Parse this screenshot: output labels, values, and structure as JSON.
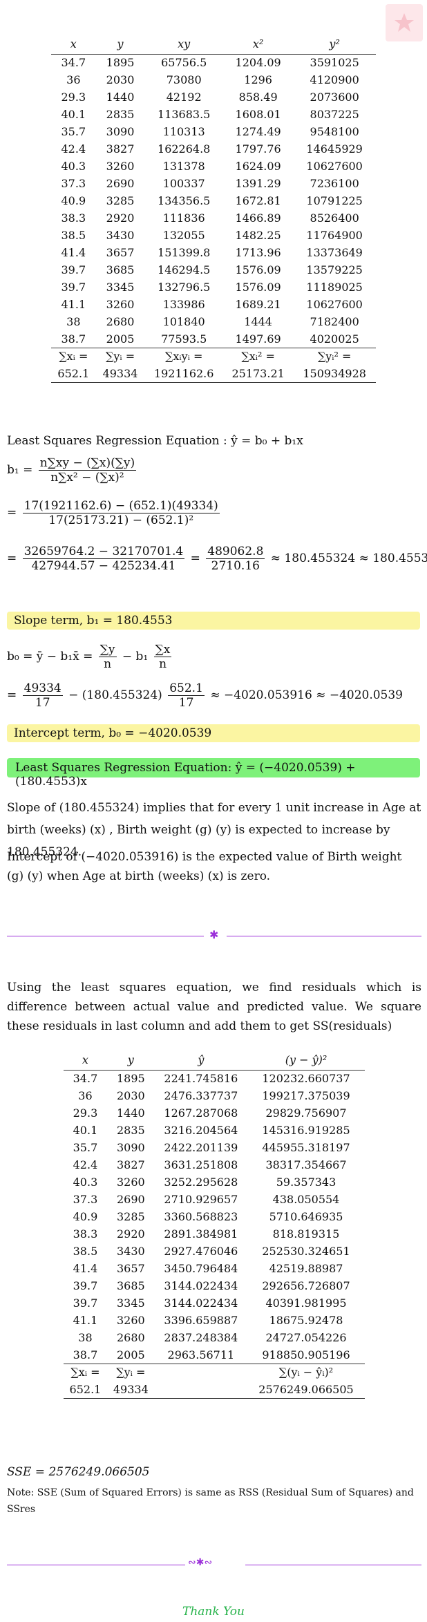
{
  "table1": {
    "headers": [
      "x",
      "y",
      "xy",
      "x²",
      "y²"
    ],
    "rows": [
      [
        "34.7",
        "1895",
        "65756.5",
        "1204.09",
        "3591025"
      ],
      [
        "36",
        "2030",
        "73080",
        "1296",
        "4120900"
      ],
      [
        "29.3",
        "1440",
        "42192",
        "858.49",
        "2073600"
      ],
      [
        "40.1",
        "2835",
        "113683.5",
        "1608.01",
        "8037225"
      ],
      [
        "35.7",
        "3090",
        "110313",
        "1274.49",
        "9548100"
      ],
      [
        "42.4",
        "3827",
        "162264.8",
        "1797.76",
        "14645929"
      ],
      [
        "40.3",
        "3260",
        "131378",
        "1624.09",
        "10627600"
      ],
      [
        "37.3",
        "2690",
        "100337",
        "1391.29",
        "7236100"
      ],
      [
        "40.9",
        "3285",
        "134356.5",
        "1672.81",
        "10791225"
      ],
      [
        "38.3",
        "2920",
        "111836",
        "1466.89",
        "8526400"
      ],
      [
        "38.5",
        "3430",
        "132055",
        "1482.25",
        "11764900"
      ],
      [
        "41.4",
        "3657",
        "151399.8",
        "1713.96",
        "13373649"
      ],
      [
        "39.7",
        "3685",
        "146294.5",
        "1576.09",
        "13579225"
      ],
      [
        "39.7",
        "3345",
        "132796.5",
        "1576.09",
        "11189025"
      ],
      [
        "41.1",
        "3260",
        "133986",
        "1689.21",
        "10627600"
      ],
      [
        "38",
        "2680",
        "101840",
        "1444",
        "7182400"
      ],
      [
        "38.7",
        "2005",
        "77593.5",
        "1497.69",
        "4020025"
      ]
    ],
    "sum_labels": [
      "∑xᵢ =",
      "∑yᵢ =",
      "∑xᵢyᵢ =",
      "∑xᵢ² =",
      "∑yᵢ² ="
    ],
    "sum_values": [
      "652.1",
      "49334",
      "1921162.6",
      "25173.21",
      "150934928"
    ]
  },
  "regression": {
    "eq_title": "Least Squares Regression Equation : ŷ = b₀ + b₁x",
    "b1_formula": "b₁ =",
    "b1_num": "n∑xy − (∑x)(∑y)",
    "b1_den": "n∑x² − (∑x)²",
    "sub_num": "17(1921162.6) − (652.1)(49334)",
    "sub_den": "17(25173.21) − (652.1)²",
    "calc_num1": "32659764.2 − 32170701.4",
    "calc_den1": "427944.57 − 425234.41",
    "calc_num2": "489062.8",
    "calc_den2": "2710.16",
    "calc_result": "≈ 180.455324 ≈ 180.4553",
    "slope_box": "Slope term, b₁ = 180.4553",
    "b0_lhs": "b₀ = ȳ − b₁x̄ =",
    "b0_num1": "∑y",
    "b0_den1": "n",
    "b0_mid": "− b₁",
    "b0_num2": "∑x",
    "b0_den2": "n",
    "b0_sub_num1": "49334",
    "b0_sub_den1": "17",
    "b0_sub_mid": "− (180.455324)",
    "b0_sub_num2": "652.1",
    "b0_sub_den2": "17",
    "b0_result": "≈ −4020.053916 ≈ −4020.0539",
    "intercept_box": "Intercept term, b₀ = −4020.0539",
    "final_box": "Least Squares Regression Equation: ŷ = (−4020.0539) + (180.4553)x"
  },
  "interpretation": {
    "slope_text": "Slope of (180.455324) implies that for every 1 unit increase in Age at birth (weeks) (x) , Birth weight (g) (y) is expected to increase by 180.455324.",
    "intercept_text": "Intercept of (−4020.053916) is the expected value of Birth weight (g) (y) when Age at birth (weeks) (x) is zero."
  },
  "residuals_intro": "Using the least squares equation, we find residuals which is difference between actual value and predicted value. We square these residuals in last column and add them to get SS(residuals)",
  "table2": {
    "headers": [
      "x",
      "y",
      "ŷ",
      "(y − ŷ)²"
    ],
    "rows": [
      [
        "34.7",
        "1895",
        "2241.745816",
        "120232.660737"
      ],
      [
        "36",
        "2030",
        "2476.337737",
        "199217.375039"
      ],
      [
        "29.3",
        "1440",
        "1267.287068",
        "29829.756907"
      ],
      [
        "40.1",
        "2835",
        "3216.204564",
        "145316.919285"
      ],
      [
        "35.7",
        "3090",
        "2422.201139",
        "445955.318197"
      ],
      [
        "42.4",
        "3827",
        "3631.251808",
        "38317.354667"
      ],
      [
        "40.3",
        "3260",
        "3252.295628",
        "59.357343"
      ],
      [
        "37.3",
        "2690",
        "2710.929657",
        "438.050554"
      ],
      [
        "40.9",
        "3285",
        "3360.568823",
        "5710.646935"
      ],
      [
        "38.3",
        "2920",
        "2891.384981",
        "818.819315"
      ],
      [
        "38.5",
        "3430",
        "2927.476046",
        "252530.324651"
      ],
      [
        "41.4",
        "3657",
        "3450.796484",
        "42519.88987"
      ],
      [
        "39.7",
        "3685",
        "3144.022434",
        "292656.726807"
      ],
      [
        "39.7",
        "3345",
        "3144.022434",
        "40391.981995"
      ],
      [
        "41.1",
        "3260",
        "3396.659887",
        "18675.92478"
      ],
      [
        "38",
        "2680",
        "2837.248384",
        "24727.054226"
      ],
      [
        "38.7",
        "2005",
        "2963.56711",
        "918850.905196"
      ]
    ],
    "sum_labels": [
      "∑xᵢ =",
      "∑yᵢ =",
      "",
      "∑(yᵢ − ŷᵢ)²"
    ],
    "sum_values": [
      "652.1",
      "49334",
      "",
      "2576249.066505"
    ]
  },
  "sse_line": "SSE = 2576249.066505",
  "note": "Note: SSE (Sum of Squared Errors) is same as RSS (Residual Sum of Squares) and SSres",
  "thanks": "Thank You",
  "colors": {
    "yellow_box": "#fbf5a2",
    "green_box": "#7ef17a",
    "divider": "#9b30d9",
    "thanks": "#26b34a"
  }
}
